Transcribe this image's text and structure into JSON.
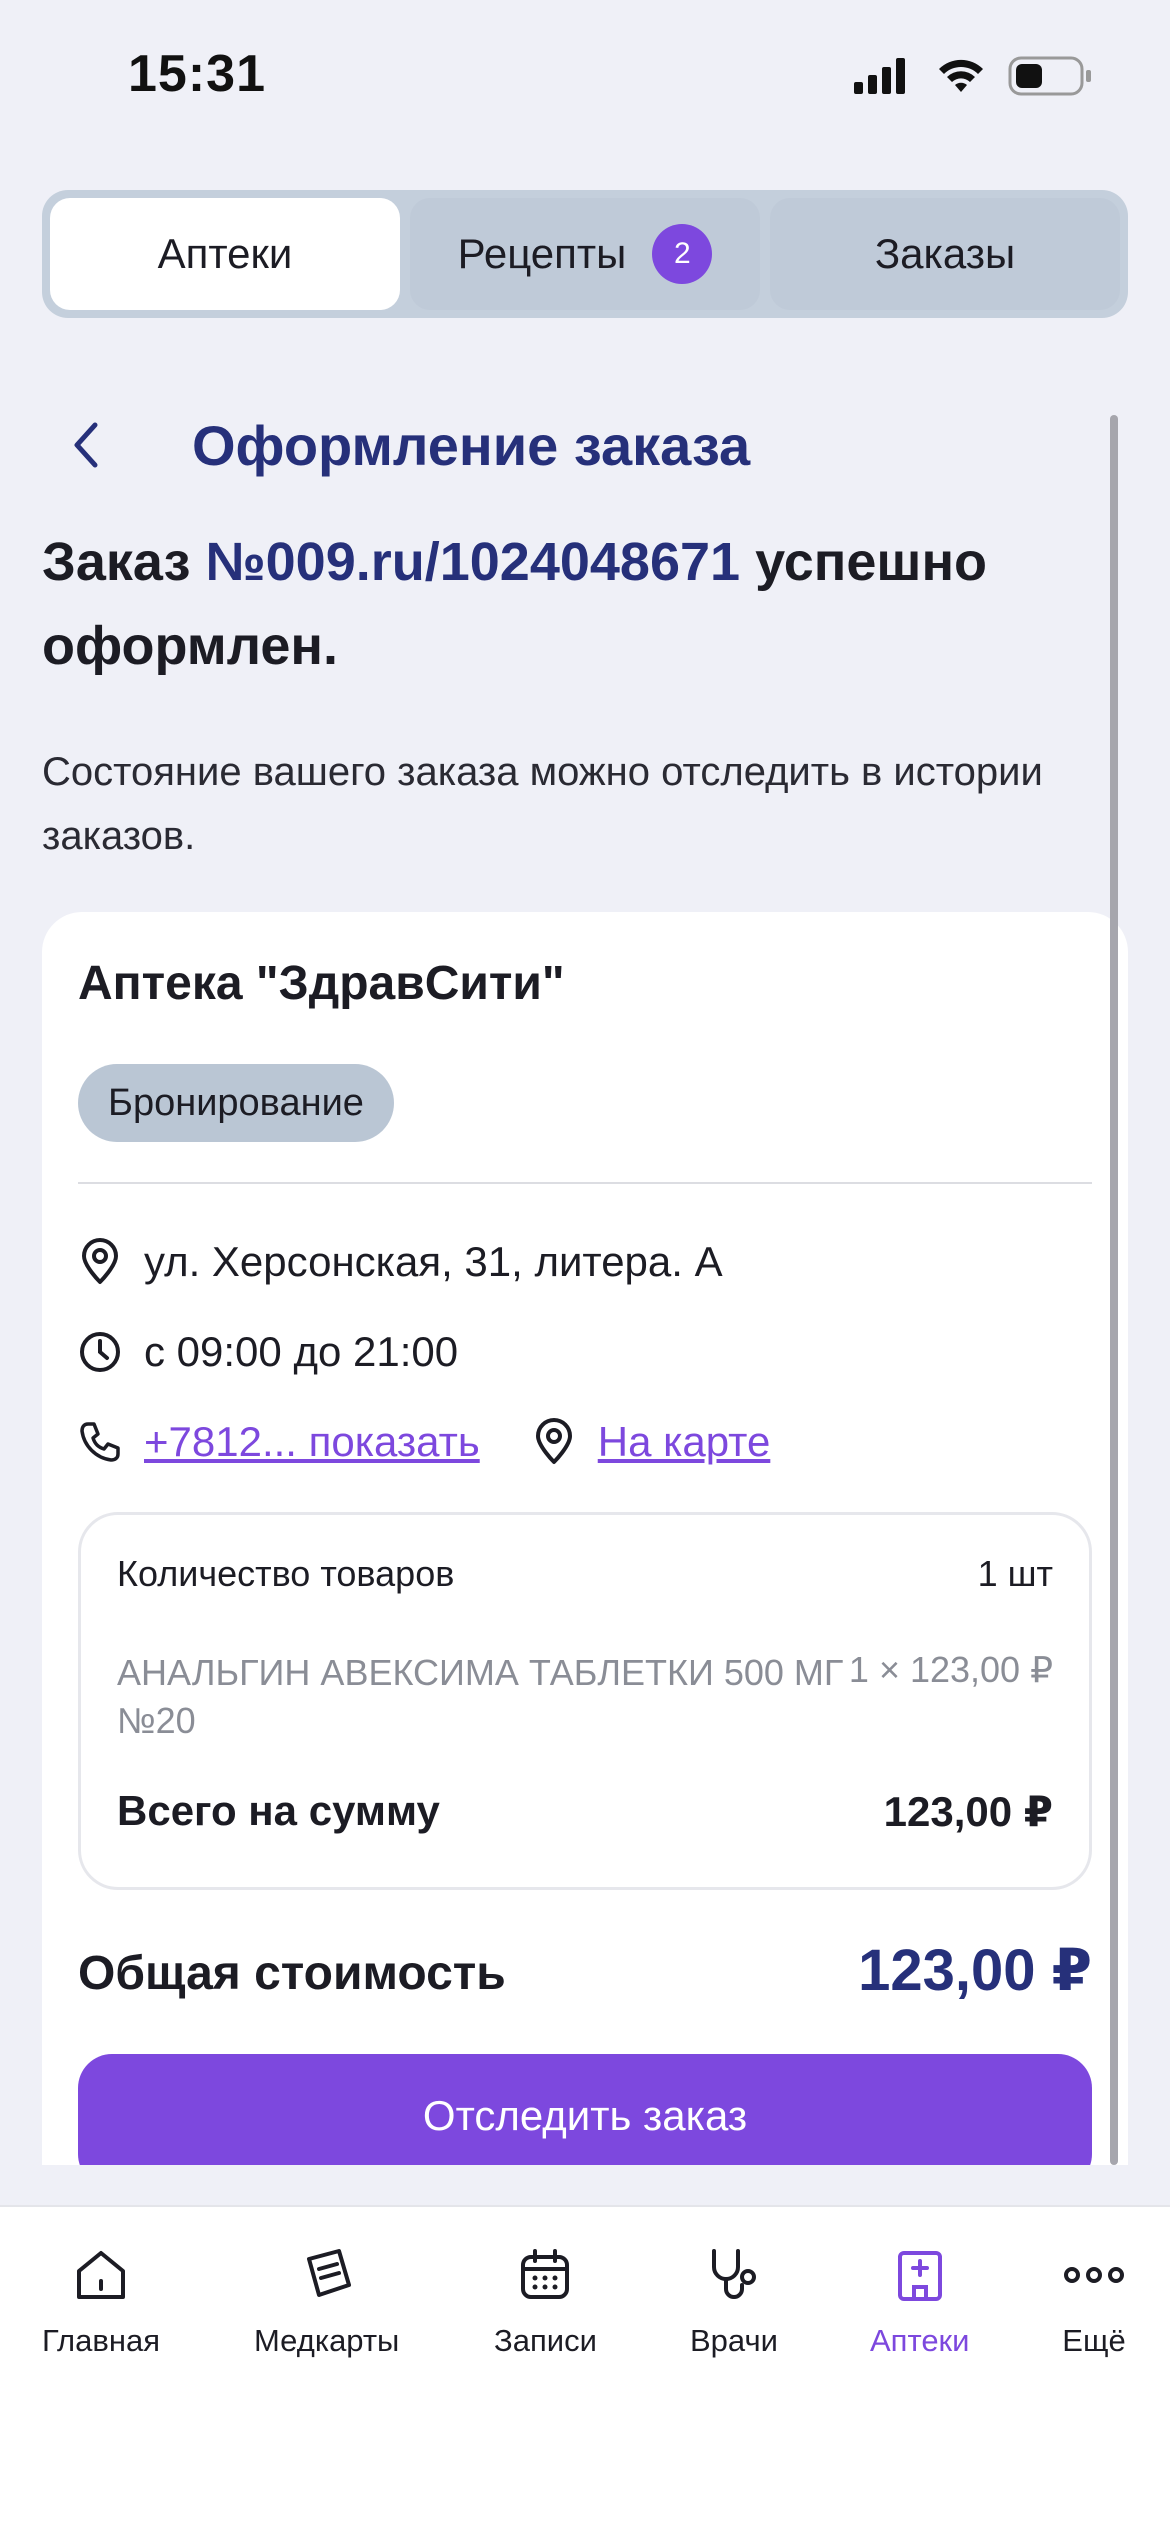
{
  "status_bar": {
    "time": "15:31"
  },
  "tabs": [
    {
      "label": "Аптеки",
      "active": true
    },
    {
      "label": "Рецепты",
      "badge": "2",
      "active": false
    },
    {
      "label": "Заказы",
      "active": false
    }
  ],
  "header": {
    "title": "Оформление заказа"
  },
  "success": {
    "prefix": "Заказ ",
    "order_number": "№009.ru/1024048671",
    "suffix": " успешно оформлен."
  },
  "hint": "Состояние вашего заказа можно отследить в истории заказов.",
  "pharmacy": {
    "name": "Аптека \"ЗдравСити\"",
    "type": "Бронирование",
    "address": "ул. Херсонская, 31, литера. А",
    "hours": "с 09:00 до 21:00",
    "phone": "+7812... показать",
    "map_link": "На карте"
  },
  "order_items": {
    "qty_label": "Количество товаров",
    "qty_value": "1 шт",
    "items": [
      {
        "name": "АНАЛЬГИН АВЕКСИМА ТАБЛЕТКИ 500 МГ №20",
        "price": "1 × 123,00 ₽"
      }
    ],
    "subtotal_label": "Всего на сумму",
    "subtotal_value": "123,00 ₽"
  },
  "total": {
    "label": "Общая стоимость",
    "value": "123,00 ₽"
  },
  "track_button": "Отследить заказ",
  "bottom_nav": [
    {
      "label": "Главная",
      "icon": "home-icon"
    },
    {
      "label": "Медкарты",
      "icon": "medcard-icon"
    },
    {
      "label": "Записи",
      "icon": "calendar-icon"
    },
    {
      "label": "Врачи",
      "icon": "stethoscope-icon"
    },
    {
      "label": "Аптеки",
      "icon": "pharmacy-icon",
      "active": true
    },
    {
      "label": "Ещё",
      "icon": "more-icon"
    }
  ],
  "colors": {
    "accent": "#7d48de",
    "title": "#26307a",
    "background": "#eff0f7"
  }
}
